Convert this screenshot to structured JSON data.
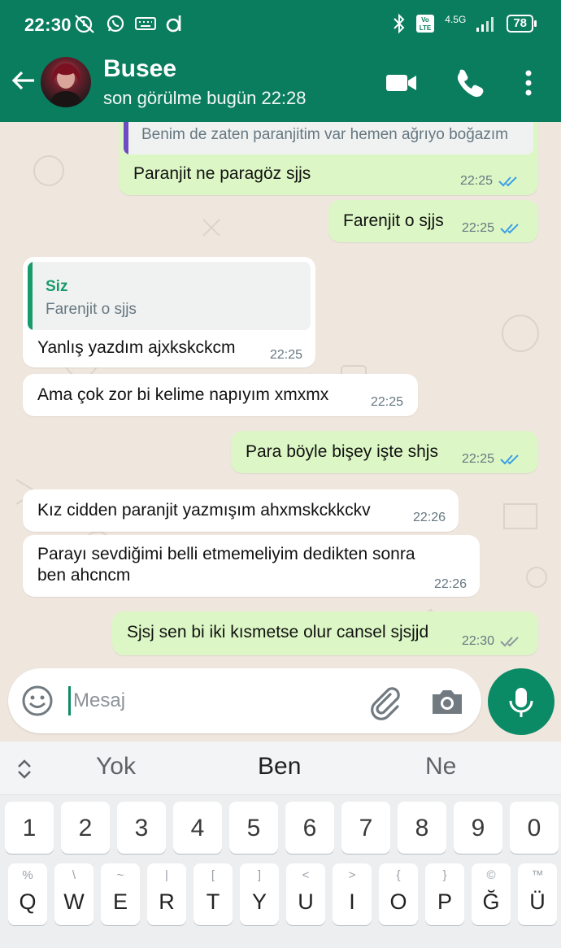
{
  "status": {
    "time": "22:30",
    "network": "4.5G",
    "battery": "78"
  },
  "header": {
    "name": "Busee",
    "last_seen": "son görülme bugün 22:28"
  },
  "messages": {
    "m1": {
      "quote_text": "Benim de zaten paranjitim var hemen ağrıyo boğazım",
      "text": "Paranjit ne paragöz sjjs",
      "time": "22:25"
    },
    "m2": {
      "text": "Farenjit o sjjs",
      "time": "22:25"
    },
    "m3": {
      "quote_name": "Siz",
      "quote_text": "Farenjit o sjjs",
      "text": "Yanlış yazdım ajxkskckcm",
      "time": "22:25"
    },
    "m4": {
      "text": "Ama çok zor bi kelime napıyım xmxmx",
      "time": "22:25"
    },
    "m5": {
      "text": "Para böyle bişey işte shjs",
      "time": "22:25"
    },
    "m6": {
      "text": "Kız cidden paranjit yazmışım ahxmskckkckv",
      "time": "22:26"
    },
    "m7": {
      "line1": "Parayı sevdiğimi belli etmemeliyim dedikten sonra",
      "line2": "ben ahcncm",
      "time": "22:26"
    },
    "m8": {
      "text": "Sjsj sen bi iki kısmetse olur cansel sjsjjd",
      "time": "22:30"
    }
  },
  "colors": {
    "header": "#0b7d5f",
    "outgoing": "#dcf7c5",
    "incoming": "#ffffff",
    "read_ticks": "#3b9ee8",
    "sent_ticks": "#8c979e",
    "accent": "#0b8a66"
  },
  "input": {
    "placeholder": "Mesaj"
  },
  "icons": [
    "back-arrow-icon",
    "video-call-icon",
    "voice-call-icon",
    "more-options-icon",
    "emoji-icon",
    "attach-icon",
    "camera-icon",
    "mic-icon",
    "suggestion-expand-icon"
  ],
  "keyboard": {
    "suggestions": [
      "Yok",
      "Ben",
      "Ne"
    ],
    "digits": [
      "1",
      "2",
      "3",
      "4",
      "5",
      "6",
      "7",
      "8",
      "9",
      "0"
    ],
    "letters": [
      "Q",
      "W",
      "E",
      "R",
      "T",
      "Y",
      "U",
      "I",
      "O",
      "P",
      "Ğ",
      "Ü"
    ],
    "hints": [
      "%",
      "\\",
      "~",
      "|",
      "[",
      "]",
      "<",
      ">",
      "{",
      "}",
      "©",
      "™"
    ]
  }
}
